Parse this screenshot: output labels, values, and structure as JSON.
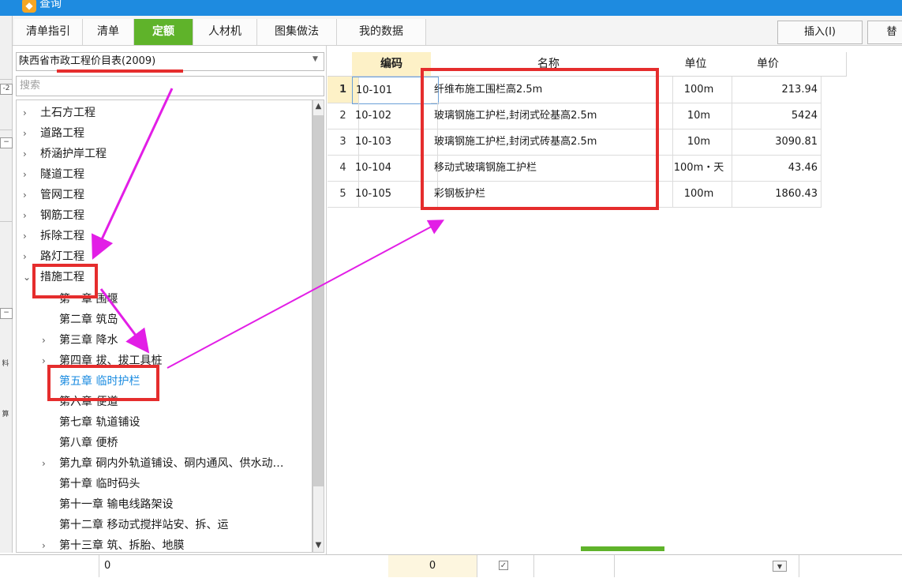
{
  "window": {
    "title": "查询"
  },
  "tabs": [
    {
      "label": "清单指引",
      "active": false
    },
    {
      "label": "清单",
      "active": false
    },
    {
      "label": "定额",
      "active": true
    },
    {
      "label": "人材机",
      "active": false
    },
    {
      "label": "图集做法",
      "active": false
    },
    {
      "label": "我的数据",
      "active": false
    }
  ],
  "toolbar": {
    "insert_label": "插入(I)",
    "replace_label": "替"
  },
  "library": {
    "selected": "陕西省市政工程价目表(2009)"
  },
  "search": {
    "placeholder": "搜索"
  },
  "tree": {
    "items": [
      {
        "label": "土石方工程"
      },
      {
        "label": "道路工程"
      },
      {
        "label": "桥涵护岸工程"
      },
      {
        "label": "隧道工程"
      },
      {
        "label": "管网工程"
      },
      {
        "label": "钢筋工程"
      },
      {
        "label": "拆除工程"
      },
      {
        "label": "路灯工程"
      },
      {
        "label": "措施工程"
      }
    ],
    "children": [
      {
        "label": "第一章 围堰"
      },
      {
        "label": "第二章 筑岛"
      },
      {
        "label": "第三章 降水"
      },
      {
        "label": "第四章 拔、拔工具桩"
      },
      {
        "label": "第五章 临时护栏"
      },
      {
        "label": "第六章 便道"
      },
      {
        "label": "第七章 轨道铺设"
      },
      {
        "label": "第八章 便桥"
      },
      {
        "label": "第九章 硐内外轨道铺设、硐内通风、供水动…"
      },
      {
        "label": "第十章 临时码头"
      },
      {
        "label": "第十一章 输电线路架设"
      },
      {
        "label": "第十二章 移动式搅拌站安、拆、运"
      },
      {
        "label": "第十三章 筑、拆胎、地膜"
      }
    ]
  },
  "table": {
    "headers": [
      "编码",
      "名称",
      "单位",
      "单价"
    ],
    "rows": [
      {
        "num": "1",
        "code": "10-101",
        "name": "纤维布施工围栏高2.5m",
        "unit": "100m",
        "price": "213.94"
      },
      {
        "num": "2",
        "code": "10-102",
        "name": "玻璃钢施工护栏,封闭式砼基高2.5m",
        "unit": "10m",
        "price": "5424"
      },
      {
        "num": "3",
        "code": "10-103",
        "name": "玻璃钢施工护栏,封闭式砖基高2.5m",
        "unit": "10m",
        "price": "3090.81"
      },
      {
        "num": "4",
        "code": "10-104",
        "name": "移动式玻璃钢施工护栏",
        "unit": "100m・天",
        "price": "43.46"
      },
      {
        "num": "5",
        "code": "10-105",
        "name": "彩钢板护栏",
        "unit": "100m",
        "price": "1860.43"
      }
    ]
  },
  "left_strip": {
    "marks": [
      "-2",
      "料",
      "算"
    ]
  },
  "statusbar": {
    "left_value": "0",
    "mid_value": "0"
  },
  "colors": {
    "accent": "#5fb32a",
    "titlebar": "#1e8be0",
    "highlight": "#e52d2d",
    "arrow": "#e21ee6"
  }
}
